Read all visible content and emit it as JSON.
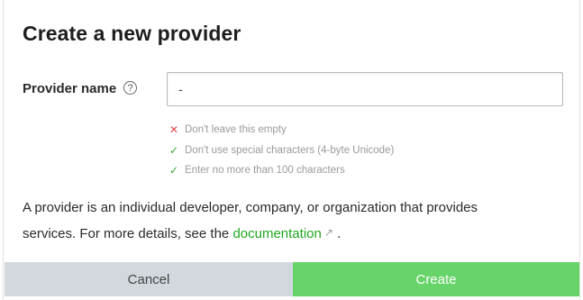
{
  "dialog": {
    "title": "Create a new provider",
    "field": {
      "label": "Provider name",
      "help_icon": "question-circle-icon",
      "help_glyph": "?",
      "value": "-"
    },
    "rules": [
      {
        "status": "fail",
        "icon": "x-icon",
        "glyph": "✕",
        "text": "Don't leave this empty"
      },
      {
        "status": "pass",
        "icon": "check-icon",
        "glyph": "✓",
        "text": "Don't use special characters (4-byte Unicode)"
      },
      {
        "status": "pass",
        "icon": "check-icon",
        "glyph": "✓",
        "text": "Enter no more than 100 characters"
      }
    ],
    "description": {
      "text": "A provider is an individual developer, company, or organization that provides services. For more details, see the ",
      "link_text": "documentation",
      "link_icon": "external-link-icon",
      "link_glyph": "↗",
      "suffix": " ."
    },
    "buttons": {
      "cancel": "Cancel",
      "create": "Create"
    },
    "colors": {
      "accent_green": "#66d468",
      "link_green": "#21a621",
      "error_red": "#e04848",
      "cancel_gray": "#d3d8df"
    }
  }
}
